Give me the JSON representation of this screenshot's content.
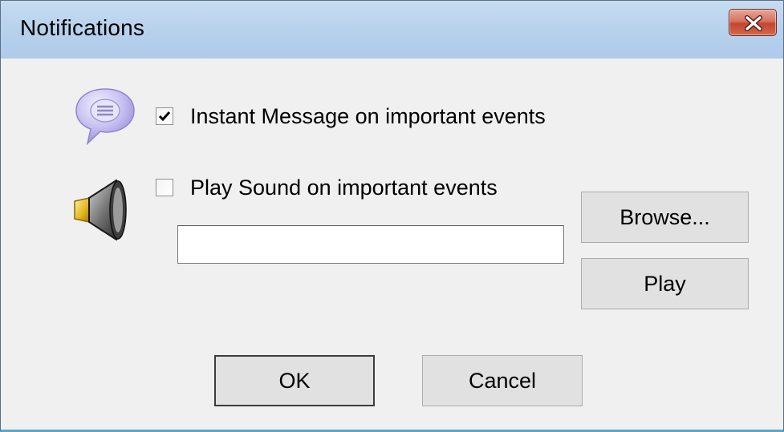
{
  "window": {
    "title": "Notifications"
  },
  "options": {
    "instant_message": {
      "label": "Instant Message on important events",
      "checked": true
    },
    "play_sound": {
      "label": "Play Sound on important events",
      "checked": false
    },
    "sound_file": {
      "value": "",
      "placeholder": ""
    }
  },
  "buttons": {
    "browse": "Browse...",
    "play": "Play",
    "ok": "OK",
    "cancel": "Cancel"
  },
  "icons": {
    "close": "close-icon",
    "chat": "chat-bubble-icon",
    "speaker": "speaker-icon",
    "checkmark": "checkmark-icon"
  },
  "colors": {
    "titlebar": "#b9d2ec",
    "close_button": "#c4452f",
    "client_background": "#f0f0f0",
    "button_face": "#e1e1e1"
  }
}
